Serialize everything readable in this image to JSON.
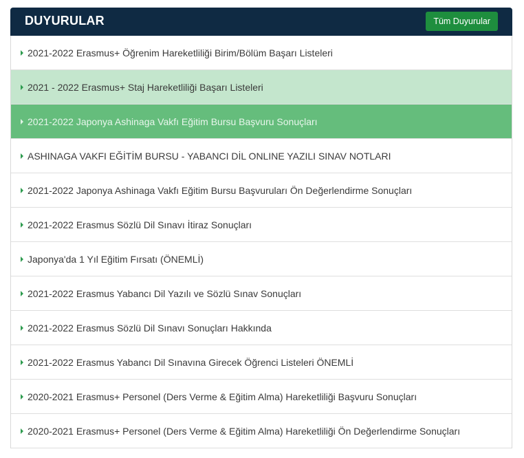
{
  "panel": {
    "title": "DUYURULAR",
    "all_button_label": "Tüm Duyurular"
  },
  "colors": {
    "header_bg": "#0f2a43",
    "button_bg": "#1e8e3e",
    "hover_bg": "#c4e6cd",
    "active_bg": "#65bd7c",
    "caret": "#2e9b4f"
  },
  "icons": {
    "item_bullet": "caret-right-icon"
  },
  "announcements": [
    {
      "label": "2021-2022 Erasmus+ Öğrenim Hareketliliği Birim/Bölüm Başarı Listeleri",
      "state": "normal"
    },
    {
      "label": "2021 - 2022 Erasmus+ Staj Hareketliliği Başarı Listeleri",
      "state": "hover"
    },
    {
      "label": "2021-2022 Japonya Ashinaga Vakfı Eğitim Bursu Başvuru Sonuçları",
      "state": "active"
    },
    {
      "label": "ASHINAGA VAKFI EĞİTİM BURSU - YABANCI DİL ONLINE YAZILI SINAV NOTLARI",
      "state": "normal"
    },
    {
      "label": "2021-2022 Japonya Ashinaga Vakfı Eğitim Bursu Başvuruları Ön Değerlendirme Sonuçları",
      "state": "normal"
    },
    {
      "label": "2021-2022 Erasmus Sözlü Dil Sınavı İtiraz Sonuçları",
      "state": "normal"
    },
    {
      "label": "Japonya'da 1 Yıl Eğitim Fırsatı (ÖNEMLİ)",
      "state": "normal"
    },
    {
      "label": "2021-2022 Erasmus Yabancı Dil Yazılı ve Sözlü Sınav Sonuçları",
      "state": "normal"
    },
    {
      "label": "2021-2022 Erasmus Sözlü Dil Sınavı Sonuçları Hakkında",
      "state": "normal"
    },
    {
      "label": "2021-2022 Erasmus Yabancı Dil Sınavına Girecek Öğrenci Listeleri ÖNEMLİ",
      "state": "normal"
    },
    {
      "label": "2020-2021 Erasmus+ Personel (Ders Verme & Eğitim Alma) Hareketliliği Başvuru Sonuçları",
      "state": "normal"
    },
    {
      "label": "2020-2021 Erasmus+ Personel (Ders Verme & Eğitim Alma) Hareketliliği Ön Değerlendirme Sonuçları",
      "state": "normal"
    }
  ]
}
